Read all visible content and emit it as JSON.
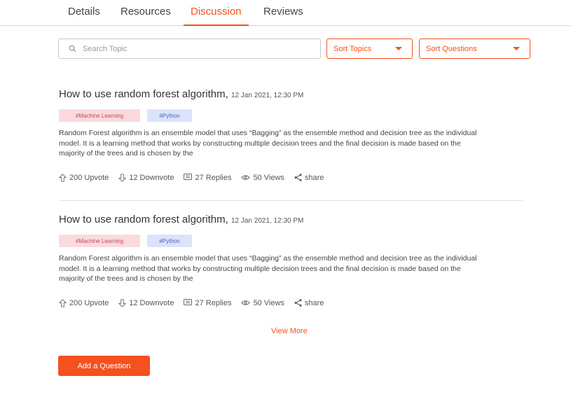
{
  "tabs": [
    {
      "label": "Details",
      "active": false
    },
    {
      "label": "Resources",
      "active": false
    },
    {
      "label": "Discussion",
      "active": true
    },
    {
      "label": "Reviews",
      "active": false
    }
  ],
  "search": {
    "placeholder": "Search Topic",
    "icon": "search-icon"
  },
  "filters": {
    "sort_topics": "Sort Topics",
    "sort_questions": "Sort Questions"
  },
  "posts": [
    {
      "title": "How to use random forest algorithm,",
      "date": "12 Jan 2021, 12:30 PM",
      "tags": [
        "#Machine Learning",
        "#Python"
      ],
      "body": "Random Forest algorithm is an ensemble model that uses “Bagging” as the ensemble method and decision tree as the individual model. It is a learning method that works by constructing multiple decision trees and the final decision is made based on the majority of the trees and is chosen by the",
      "stats": {
        "upvote": "200 Upvote",
        "downvote": "12 Downvote",
        "replies": "27 Replies",
        "views": "50 Views",
        "share": "share"
      }
    },
    {
      "title": "How to use random forest algorithm,",
      "date": "12 Jan 2021, 12:30 PM",
      "tags": [
        "#Machine Learning",
        "#Python"
      ],
      "body": "Random Forest algorithm is an ensemble model that uses “Bagging” as the ensemble method and decision tree as the individual model. It is a learning method that works by constructing multiple decision trees and the final decision is made based on the majority of the trees and is chosen by the",
      "stats": {
        "upvote": "200 Upvote",
        "downvote": "12 Downvote",
        "replies": "27 Replies",
        "views": "50 Views",
        "share": "share"
      }
    }
  ],
  "view_more": "View More",
  "add_question": "Add a Question",
  "colors": {
    "accent": "#f4511e",
    "tag_ml_bg": "#fadadd",
    "tag_py_bg": "#dbe3fb"
  }
}
